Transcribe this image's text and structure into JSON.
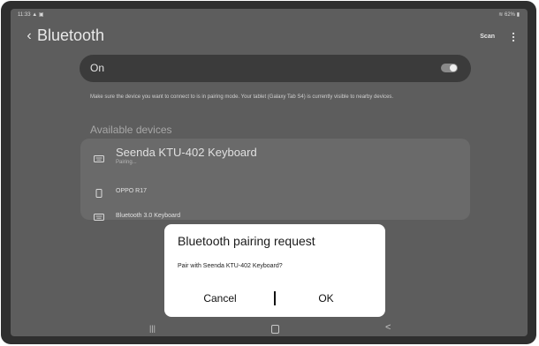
{
  "status_bar": {
    "time": "11:33",
    "left_icons": "▲ ▣",
    "right_text": "62%"
  },
  "header": {
    "title": "Bluetooth",
    "scan_label": "Scan"
  },
  "toggle": {
    "label": "On",
    "state": "on"
  },
  "info_text": "Make sure the device you want to connect to is in pairing mode. Your tablet (Galaxy Tab S4) is currently visible to nearby devices.",
  "available_devices": {
    "title": "Available devices",
    "items": [
      {
        "name": "Seenda KTU-402 Keyboard",
        "status": "Pairing...",
        "icon": "keyboard-icon"
      },
      {
        "name": "OPPO R17",
        "status": "",
        "icon": "phone-icon"
      },
      {
        "name": "Bluetooth 3.0 Keyboard",
        "status": "",
        "icon": "keyboard-icon"
      }
    ]
  },
  "dialog": {
    "title": "Bluetooth pairing request",
    "message": "Pair with Seenda KTU-402 Keyboard?",
    "cancel_label": "Cancel",
    "ok_label": "OK"
  },
  "nav_bar": {
    "recents": "|||",
    "back": "<"
  }
}
